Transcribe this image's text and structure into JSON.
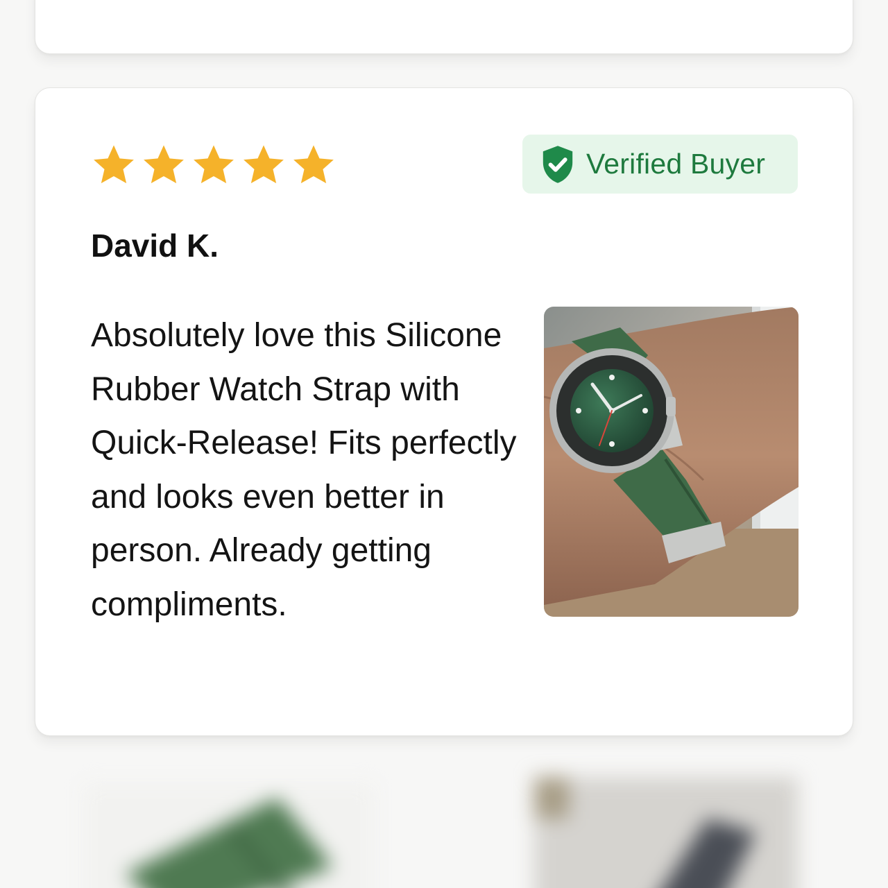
{
  "review": {
    "rating": 5,
    "rating_max": 5,
    "badge_label": "Verified Buyer",
    "reviewer_name": "David K.",
    "text": "Absolutely love this Silicone Rubber Watch Strap with Quick-Release! Fits perfectly and looks even better in person. Already getting compliments.",
    "photo_icon": "customer-photo-green-watch-on-wrist"
  },
  "colors": {
    "star": "#f5b22a",
    "badge_background": "#e6f6ea",
    "badge_text": "#1e7a3e",
    "strap_green": "#3f6b48"
  }
}
